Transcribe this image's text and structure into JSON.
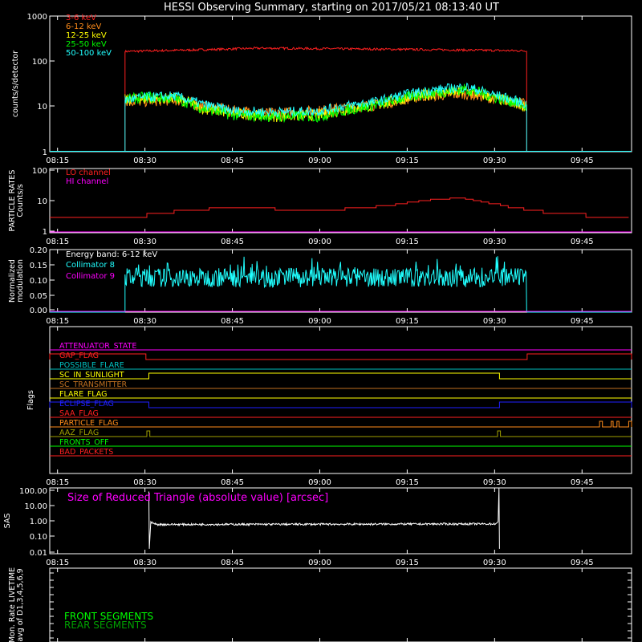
{
  "title": "HESSI Observing Summary, starting on 2017/05/21 08:13:40 UT",
  "time_ticks": [
    "08:15",
    "08:30",
    "08:45",
    "09:00",
    "09:15",
    "09:30",
    "09:45"
  ],
  "colors": {
    "background": "#000000",
    "frame": "#ffffff",
    "red": "#ff2020",
    "orange": "#ff8c1a",
    "yellow": "#ffff00",
    "green": "#00ff00",
    "cyan": "#20ffff",
    "magenta": "#ff00ff",
    "blue": "#2020ff",
    "teal": "#00c0c0",
    "dark_orange": "#c07020",
    "olive": "#a0a000",
    "dark_green": "#00a000",
    "white": "#ffffff"
  },
  "chart_data": [
    {
      "id": "count_rates",
      "type": "line",
      "ylabel": "counts/s/detector",
      "yscale": "log",
      "ylim": [
        1,
        1000
      ],
      "ytick_labels": [
        "1000",
        "100",
        "10",
        "1"
      ],
      "xlim": [
        "08:13:40",
        "09:53:30"
      ],
      "series": [
        {
          "name": "3-6 keV",
          "color": "red",
          "points": [
            [
              "08:13:40",
              1
            ],
            [
              "08:26:30",
              1
            ],
            [
              "08:26:35",
              165
            ],
            [
              "08:40:00",
              180
            ],
            [
              "08:50:00",
              195
            ],
            [
              "09:00:00",
              190
            ],
            [
              "09:10:00",
              185
            ],
            [
              "09:20:00",
              180
            ],
            [
              "09:35:30",
              170
            ],
            [
              "09:35:35",
              1
            ],
            [
              "09:53:30",
              1
            ]
          ]
        },
        {
          "name": "6-12 keV",
          "color": "orange",
          "points": [
            [
              "08:26:35",
              13
            ],
            [
              "08:30:00",
              13
            ],
            [
              "08:35:00",
              14
            ],
            [
              "08:40:00",
              10
            ],
            [
              "08:45:00",
              8
            ],
            [
              "08:52:00",
              7
            ],
            [
              "09:00:00",
              8
            ],
            [
              "09:10:00",
              11
            ],
            [
              "09:18:00",
              17
            ],
            [
              "09:25:00",
              19
            ],
            [
              "09:30:00",
              15
            ],
            [
              "09:35:30",
              11
            ]
          ]
        },
        {
          "name": "12-25 keV",
          "color": "yellow",
          "points": [
            [
              "08:26:35",
              14
            ],
            [
              "08:30:00",
              15
            ],
            [
              "08:35:00",
              15
            ],
            [
              "08:40:00",
              9
            ],
            [
              "08:45:00",
              7
            ],
            [
              "08:52:00",
              6
            ],
            [
              "09:00:00",
              6.5
            ],
            [
              "09:10:00",
              11
            ],
            [
              "09:18:00",
              18
            ],
            [
              "09:25:00",
              22
            ],
            [
              "09:30:00",
              15
            ],
            [
              "09:35:30",
              10
            ]
          ]
        },
        {
          "name": "25-50 keV",
          "color": "green",
          "points": [
            [
              "08:26:35",
              14
            ],
            [
              "08:30:00",
              16
            ],
            [
              "08:35:00",
              15
            ],
            [
              "08:40:00",
              9
            ],
            [
              "08:45:00",
              6.5
            ],
            [
              "08:52:00",
              6
            ],
            [
              "09:00:00",
              6
            ],
            [
              "09:10:00",
              11
            ],
            [
              "09:18:00",
              19
            ],
            [
              "09:25:00",
              24
            ],
            [
              "09:30:00",
              16
            ],
            [
              "09:35:30",
              10
            ]
          ]
        },
        {
          "name": "50-100 keV",
          "color": "cyan",
          "points": [
            [
              "08:13:40",
              1
            ],
            [
              "08:26:30",
              1
            ],
            [
              "08:26:35",
              14
            ],
            [
              "08:30:00",
              16
            ],
            [
              "08:35:00",
              17
            ],
            [
              "08:40:00",
              11
            ],
            [
              "08:45:00",
              8
            ],
            [
              "08:52:00",
              7.5
            ],
            [
              "09:00:00",
              8
            ],
            [
              "09:10:00",
              13
            ],
            [
              "09:18:00",
              22
            ],
            [
              "09:25:00",
              27
            ],
            [
              "09:30:00",
              18
            ],
            [
              "09:35:30",
              11
            ],
            [
              "09:35:35",
              1
            ],
            [
              "09:53:30",
              1
            ]
          ]
        }
      ]
    },
    {
      "id": "particle_rates",
      "type": "line",
      "ylabel": "PARTICLE RATES\nCounts/s",
      "yscale": "log",
      "ylim": [
        1,
        100
      ],
      "ytick_labels": [
        "100",
        "10",
        "1"
      ],
      "xlim": [
        "08:13:40",
        "09:53:30"
      ],
      "series": [
        {
          "name": "LO channel",
          "color": "red",
          "points": [
            [
              "08:13:40",
              3
            ],
            [
              "08:30:00",
              3.5
            ],
            [
              "08:37:00",
              5
            ],
            [
              "08:44:00",
              6
            ],
            [
              "08:52:00",
              5.5
            ],
            [
              "09:00:00",
              5
            ],
            [
              "09:08:00",
              6
            ],
            [
              "09:14:00",
              8
            ],
            [
              "09:20:00",
              11
            ],
            [
              "09:24:00",
              12
            ],
            [
              "09:28:00",
              9
            ],
            [
              "09:33:00",
              6
            ],
            [
              "09:38:00",
              4.5
            ],
            [
              "09:45:00",
              3.5
            ],
            [
              "09:53:30",
              3
            ]
          ]
        },
        {
          "name": "HI channel",
          "color": "magenta",
          "points": [
            [
              "08:13:40",
              1
            ],
            [
              "09:53:30",
              1
            ]
          ]
        }
      ]
    },
    {
      "id": "modulation",
      "type": "line",
      "ylabel": "Normalized\nmodulation",
      "annotation": "Energy band: 6-12 keV",
      "ylim": [
        0,
        0.2
      ],
      "ytick_labels": [
        "0.20",
        "0.15",
        "0.10",
        "0.05",
        "0.00"
      ],
      "xlim": [
        "08:13:40",
        "09:53:30"
      ],
      "series": [
        {
          "name": "Collimator 8",
          "color": "cyan",
          "points": [
            [
              "08:13:40",
              0
            ],
            [
              "08:26:30",
              0
            ],
            [
              "08:26:35",
              0.11
            ],
            [
              "09:35:30",
              0.11
            ],
            [
              "09:35:35",
              0
            ],
            [
              "09:53:30",
              0
            ]
          ]
        },
        {
          "name": "Collimator 9",
          "color": "magenta",
          "points": [
            [
              "08:13:40",
              0
            ],
            [
              "09:53:30",
              0
            ]
          ]
        }
      ]
    },
    {
      "id": "flags",
      "type": "line",
      "ylabel": "Flags",
      "xlim": [
        "08:13:40",
        "09:53:30"
      ],
      "series": [
        {
          "name": "ATTENUATOR_STATE",
          "color": "magenta",
          "on": []
        },
        {
          "name": "GAP_FLAG",
          "color": "red",
          "on": [
            [
              "08:13:40",
              "08:30:10"
            ],
            [
              "09:35:35",
              "09:53:30"
            ]
          ]
        },
        {
          "name": "POSSIBLE_FLARE",
          "color": "teal",
          "on": []
        },
        {
          "name": "SC_IN_SUNLIGHT",
          "color": "yellow",
          "on": [
            [
              "08:30:40",
              "09:30:50"
            ]
          ]
        },
        {
          "name": "SC_TRANSMITTER",
          "color": "dark_orange",
          "on": []
        },
        {
          "name": "FLARE_FLAG",
          "color": "yellow",
          "on": []
        },
        {
          "name": "ECLIPSE_FLAG",
          "color": "blue",
          "on": [
            [
              "08:13:40",
              "08:30:40"
            ],
            [
              "09:30:50",
              "09:53:30"
            ]
          ]
        },
        {
          "name": "SAA_FLAG",
          "color": "red",
          "on": []
        },
        {
          "name": "PARTICLE_FLAG",
          "color": "orange",
          "on": [
            [
              "09:48:00",
              "09:48:30"
            ],
            [
              "09:50:00",
              "09:50:20"
            ],
            [
              "09:51:00",
              "09:51:20"
            ],
            [
              "09:53:00",
              "09:53:30"
            ]
          ]
        },
        {
          "name": "AAZ_FLAG",
          "color": "olive",
          "on": [
            [
              "08:30:20",
              "08:30:50"
            ],
            [
              "09:30:30",
              "09:31:00"
            ]
          ]
        },
        {
          "name": "FRONTS_OFF",
          "color": "green",
          "on": []
        },
        {
          "name": "BAD_PACKETS",
          "color": "red",
          "on": []
        }
      ]
    },
    {
      "id": "sas",
      "type": "line",
      "ylabel": "SAS",
      "annotation": "Size of Reduced Triangle (absolute value) [arcsec]",
      "yscale": "log",
      "ylim": [
        0.01,
        100
      ],
      "ytick_labels": [
        "100.00",
        "10.00",
        "1.00",
        "0.10",
        "0.01"
      ],
      "xlim": [
        "08:13:40",
        "09:53:30"
      ],
      "series": [
        {
          "name": "Reduced Triangle",
          "color": "white",
          "points": [
            [
              "08:30:40",
              60
            ],
            [
              "08:30:45",
              0.02
            ],
            [
              "08:31:00",
              0.8
            ],
            [
              "08:32:00",
              0.6
            ],
            [
              "09:00:00",
              0.62
            ],
            [
              "09:30:00",
              0.65
            ],
            [
              "09:30:40",
              0.8
            ],
            [
              "09:30:45",
              100
            ],
            [
              "09:30:50",
              0.02
            ]
          ]
        }
      ]
    },
    {
      "id": "livetime",
      "type": "line",
      "ylabel": "Mon. Rate LIVETIME\navg of D1,3,4,5,6,9",
      "ylim": [
        0,
        1
      ],
      "xlim": [
        "08:13:40",
        "09:53:30"
      ],
      "series": [
        {
          "name": "FRONT SEGMENTS",
          "color": "green",
          "points": []
        },
        {
          "name": "REAR SEGMENTS",
          "color": "dark_green",
          "points": []
        }
      ]
    }
  ]
}
